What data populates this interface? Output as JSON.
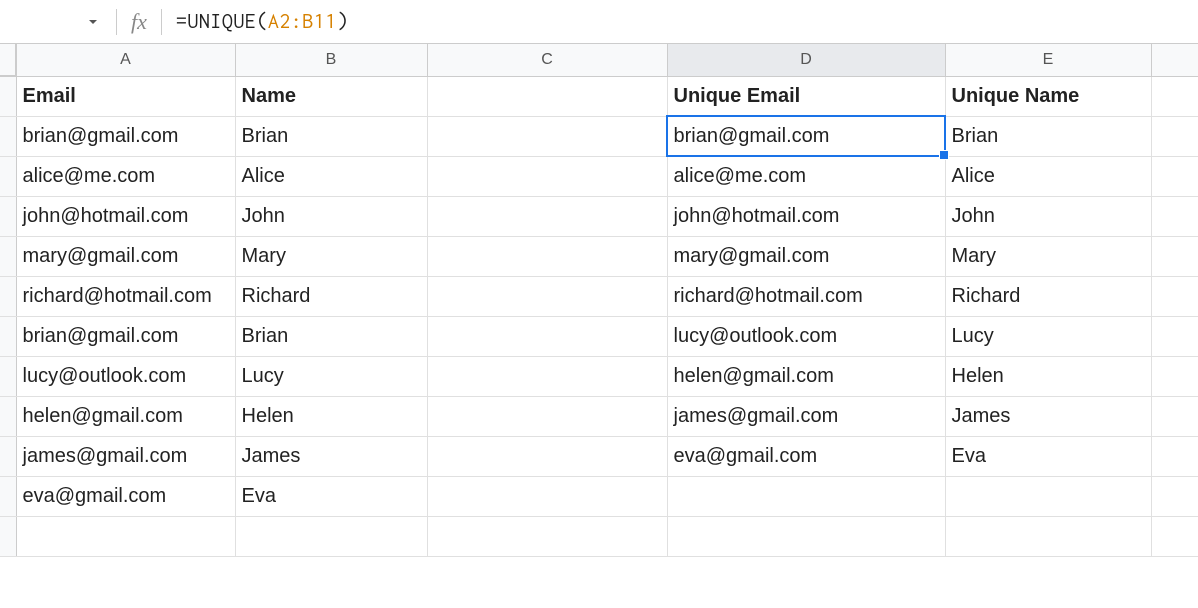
{
  "formula_bar": {
    "fx": "fx",
    "formula_prefix": "=UNIQUE(",
    "formula_ref": "A2:B11",
    "formula_suffix": ")"
  },
  "columns": [
    "A",
    "B",
    "C",
    "D",
    "E"
  ],
  "headers": {
    "A": "Email",
    "B": "Name",
    "C": "",
    "D": "Unique Email",
    "E": "Unique Name"
  },
  "rows": [
    {
      "A": "brian@gmail.com",
      "B": "Brian",
      "C": "",
      "D": "brian@gmail.com",
      "E": "Brian"
    },
    {
      "A": "alice@me.com",
      "B": "Alice",
      "C": "",
      "D": "alice@me.com",
      "E": "Alice"
    },
    {
      "A": "john@hotmail.com",
      "B": "John",
      "C": "",
      "D": "john@hotmail.com",
      "E": "John"
    },
    {
      "A": "mary@gmail.com",
      "B": "Mary",
      "C": "",
      "D": "mary@gmail.com",
      "E": "Mary"
    },
    {
      "A": "richard@hotmail.com",
      "B": "Richard",
      "C": "",
      "D": "richard@hotmail.com",
      "E": "Richard"
    },
    {
      "A": "brian@gmail.com",
      "B": "Brian",
      "C": "",
      "D": "lucy@outlook.com",
      "E": "Lucy"
    },
    {
      "A": "lucy@outlook.com",
      "B": "Lucy",
      "C": "",
      "D": "helen@gmail.com",
      "E": "Helen"
    },
    {
      "A": "helen@gmail.com",
      "B": "Helen",
      "C": "",
      "D": "james@gmail.com",
      "E": "James"
    },
    {
      "A": "james@gmail.com",
      "B": "James",
      "C": "",
      "D": "eva@gmail.com",
      "E": "Eva"
    },
    {
      "A": "eva@gmail.com",
      "B": "Eva",
      "C": "",
      "D": "",
      "E": ""
    },
    {
      "A": "",
      "B": "",
      "C": "",
      "D": "",
      "E": ""
    }
  ],
  "selected_cell": "D2"
}
